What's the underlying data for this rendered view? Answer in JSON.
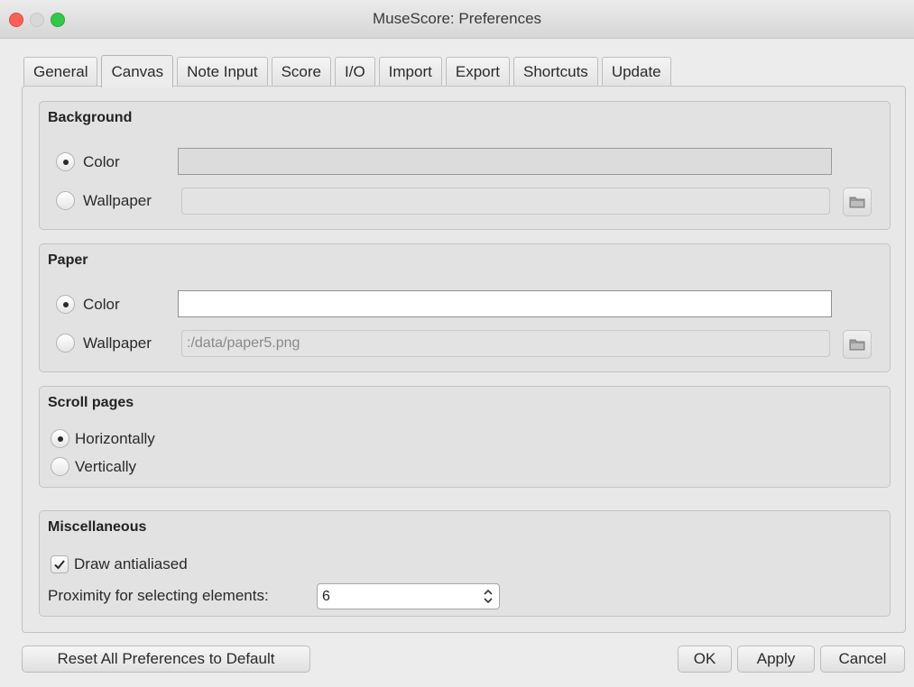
{
  "window": {
    "title": "MuseScore: Preferences"
  },
  "tabs": [
    "General",
    "Canvas",
    "Note Input",
    "Score",
    "I/O",
    "Import",
    "Export",
    "Shortcuts",
    "Update"
  ],
  "active_tab": "Canvas",
  "background": {
    "title": "Background",
    "color_label": "Color",
    "wallpaper_label": "Wallpaper",
    "color_value": "#dcdcdc",
    "wallpaper_path": ""
  },
  "paper": {
    "title": "Paper",
    "color_label": "Color",
    "wallpaper_label": "Wallpaper",
    "color_value": "#ffffff",
    "wallpaper_path": ":/data/paper5.png"
  },
  "scroll": {
    "title": "Scroll pages",
    "horizontal_label": "Horizontally",
    "vertical_label": "Vertically",
    "selected": "Horizontally"
  },
  "misc": {
    "title": "Miscellaneous",
    "antialias_label": "Draw antialiased",
    "antialias_checked": true,
    "proximity_label": "Proximity for selecting elements:",
    "proximity_value": "6"
  },
  "buttons": {
    "reset": "Reset All Preferences to Default",
    "ok": "OK",
    "apply": "Apply",
    "cancel": "Cancel"
  }
}
